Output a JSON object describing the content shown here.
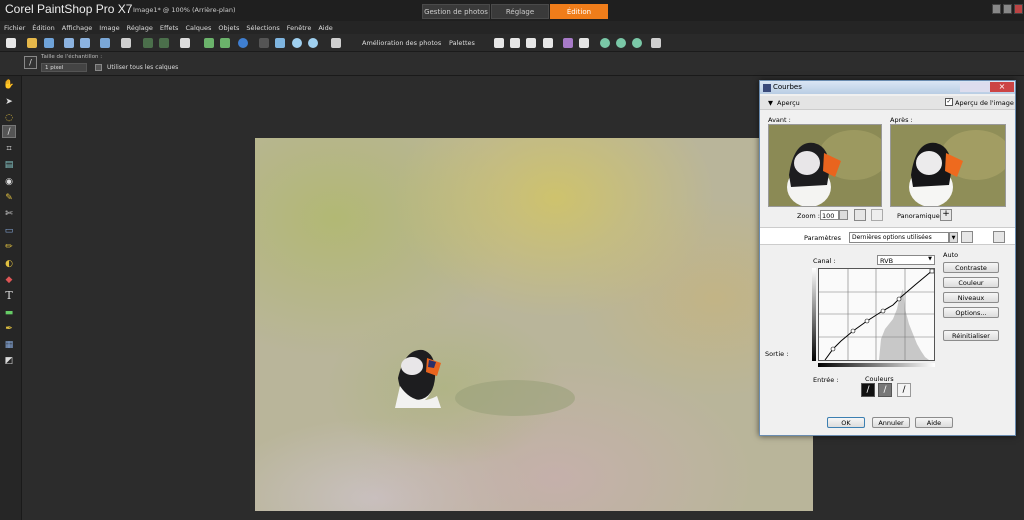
{
  "app": {
    "title": "Corel PaintShop Pro X7",
    "document": "Image1* @ 100% (Arrière-plan)"
  },
  "workspace_tabs": [
    {
      "label": "Gestion de photos"
    },
    {
      "label": "Réglage"
    },
    {
      "label": "Édition",
      "active": true
    }
  ],
  "menu": [
    "Fichier",
    "Édition",
    "Affichage",
    "Image",
    "Réglage",
    "Effets",
    "Calques",
    "Objets",
    "Sélections",
    "Fenêtre",
    "Aide"
  ],
  "toolbar": {
    "enhance_label": "Amélioration des photos",
    "palettes_label": "Palettes"
  },
  "tool_options": {
    "sample_size_label": "Taille de l'échantillon :",
    "sample_size_value": "1 pixel",
    "all_layers_label": "Utiliser tous les calques"
  },
  "accent_color": "#f07d1a",
  "dialog": {
    "title": "Courbes",
    "preview_label": "Aperçu",
    "image_preview_label": "Aperçu de l'image",
    "before_label": "Avant :",
    "after_label": "Après :",
    "zoom_label": "Zoom :",
    "zoom_value": "100",
    "pan_label": "Panoramique :",
    "presets_label": "Paramètres",
    "presets_value": "Dernières options utilisées",
    "auto_label": "Auto",
    "channel_label": "Canal :",
    "channel_value": "RVB",
    "output_label": "Sortie :",
    "input_label": "Entrée :",
    "colors_label": "Couleurs",
    "buttons": {
      "contrast": "Contraste",
      "color": "Couleur",
      "levels": "Niveaux",
      "options": "Options...",
      "reset": "Réinitialiser"
    },
    "ok": "OK",
    "cancel": "Annuler",
    "help": "Aide"
  }
}
